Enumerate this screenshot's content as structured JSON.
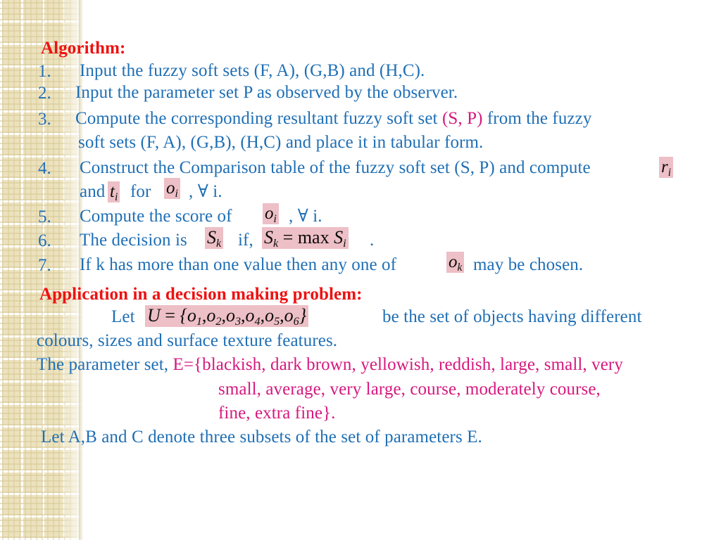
{
  "slide": {
    "background_color": "#ffffff",
    "sidebar_color": "#ece2bd",
    "accent_red": "#ee1111",
    "accent_blue": "#1f6fb5",
    "accent_magenta": "#d6187e",
    "equation_highlight": "#edbfc6"
  },
  "algorithm": {
    "heading": "Algorithm:",
    "items": [
      {
        "number": "1.",
        "text": "Input the fuzzy soft sets (F, A), (G,B) and (H,C)."
      },
      {
        "number": "2.",
        "text": "Input the parameter set P as observed by the observer."
      },
      {
        "number": "3.",
        "text_before": "Compute the corresponding resultant fuzzy soft set ",
        "highlight": "(S, P)",
        "text_after": " from the fuzzy",
        "continuation": "soft sets (F, A), (G,B), (H,C) and place it in tabular form."
      },
      {
        "number": "4.",
        "text_before": "Construct the Comparison table of the fuzzy soft set (S, P) and compute",
        "equation_1": "r_i",
        "continuation_a": "and",
        "equation_2": "t_i",
        "continuation_b": "for",
        "equation_3": "o_i",
        "continuation_c": ", ∀ i."
      },
      {
        "number": "5.",
        "text_before": "Compute the score of",
        "equation_1": "o_i",
        "text_after": ", ∀ i."
      },
      {
        "number": "6.",
        "text_before": "The decision is",
        "equation_1": "S_k",
        "text_mid": "if,",
        "equation_2": "S_k = max S_i",
        "text_after": "."
      },
      {
        "number": "7.",
        "text_before": "If k has more than one value then any one of",
        "equation_1": "o_k",
        "text_after": "may be chosen."
      }
    ]
  },
  "application": {
    "heading": "Application in a decision making problem:",
    "let_label": "Let",
    "universe_equation": "U = { o_1 , o_2 , o_3 , o_4 , o_5 , o_6 }",
    "let_tail": "be the set of objects having different",
    "let_continuation": "colours, sizes and surface texture features.",
    "parameter_label": "The parameter set,",
    "parameter_set_line1": "E={blackish, dark brown, yellowish, reddish, large, small, very",
    "parameter_set_line2": "small, average, very large, course, moderately course,",
    "parameter_set_line3": "fine, extra fine}.",
    "closing_line": "Let A,B and C denote three subsets of the set of parameters E."
  }
}
